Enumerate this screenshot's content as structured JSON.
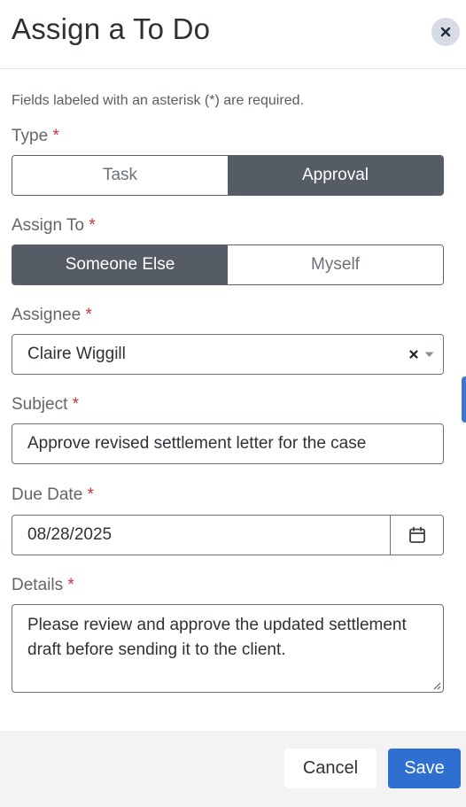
{
  "dialog": {
    "title": "Assign a To Do"
  },
  "form": {
    "required_note": "Fields labeled with an asterisk (*) are required.",
    "required_marker": "*",
    "type": {
      "label": "Type",
      "options": [
        "Task",
        "Approval"
      ],
      "selected": "Approval"
    },
    "assign_to": {
      "label": "Assign To",
      "options": [
        "Someone Else",
        "Myself"
      ],
      "selected": "Someone Else"
    },
    "assignee": {
      "label": "Assignee",
      "value": "Claire Wiggill"
    },
    "subject": {
      "label": "Subject",
      "value": "Approve revised settlement letter for the case"
    },
    "due_date": {
      "label": "Due Date",
      "value": "08/28/2025"
    },
    "details": {
      "label": "Details",
      "value": "Please review and approve the updated settlement draft before sending it to the client."
    }
  },
  "footer": {
    "cancel_label": "Cancel",
    "save_label": "Save"
  },
  "colors": {
    "accent": "#2f6fcf",
    "segment_active": "#555c66",
    "required": "#d0303a"
  },
  "icons": {
    "close": "close-icon",
    "clear": "clear-icon",
    "dropdown": "chevron-down-icon",
    "calendar": "calendar-icon"
  }
}
